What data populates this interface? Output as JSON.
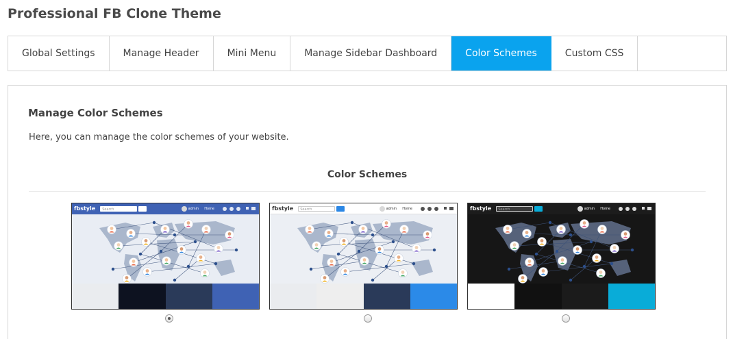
{
  "page": {
    "title": "Professional FB Clone Theme"
  },
  "tabs": [
    {
      "label": "Global Settings",
      "active": false
    },
    {
      "label": "Manage Header",
      "active": false
    },
    {
      "label": "Mini Menu",
      "active": false
    },
    {
      "label": "Manage Sidebar Dashboard",
      "active": false
    },
    {
      "label": "Color Schemes",
      "active": true
    },
    {
      "label": "Custom CSS",
      "active": false
    }
  ],
  "section": {
    "title": "Manage Color Schemes",
    "description": "Here, you can manage the color schemes of your website.",
    "schemes_heading": "Color Schemes"
  },
  "preview_labels": {
    "logo": "fbstyle",
    "search_placeholder": "Search",
    "user": "admin",
    "home": "Home"
  },
  "schemes": [
    {
      "selected": true,
      "header_bg": "#3f62b4",
      "header_text": "#ffffff",
      "search_bg": "#ffffff",
      "search_btn": "#ffffff",
      "art_bg": "#e9edf4",
      "map": "#aab7cc",
      "swatches": [
        "#eaecef",
        "#0d1220",
        "#2a3a59",
        "#3f62b4"
      ]
    },
    {
      "selected": false,
      "header_bg": "#ffffff",
      "header_text": "#333333",
      "search_bg": "#ffffff",
      "search_btn": "#2b87e5",
      "art_bg": "#eceff4",
      "map": "#aab7cc",
      "swatches": [
        "#eaecef",
        "#eeeeee",
        "#2a3a59",
        "#2b8ae8"
      ]
    },
    {
      "selected": false,
      "header_bg": "#1c1c1c",
      "header_text": "#ffffff",
      "search_bg": "#3a3a3a",
      "search_btn": "#09acd8",
      "art_bg": "#161616",
      "map": "#56627a",
      "swatches": [
        "#ffffff",
        "#111111",
        "#1b1b1b",
        "#09acd8"
      ]
    }
  ],
  "icons": [
    "search-icon",
    "globe-icon",
    "chat-icon",
    "friends-icon",
    "chevron-down-icon",
    "menu-icon"
  ]
}
